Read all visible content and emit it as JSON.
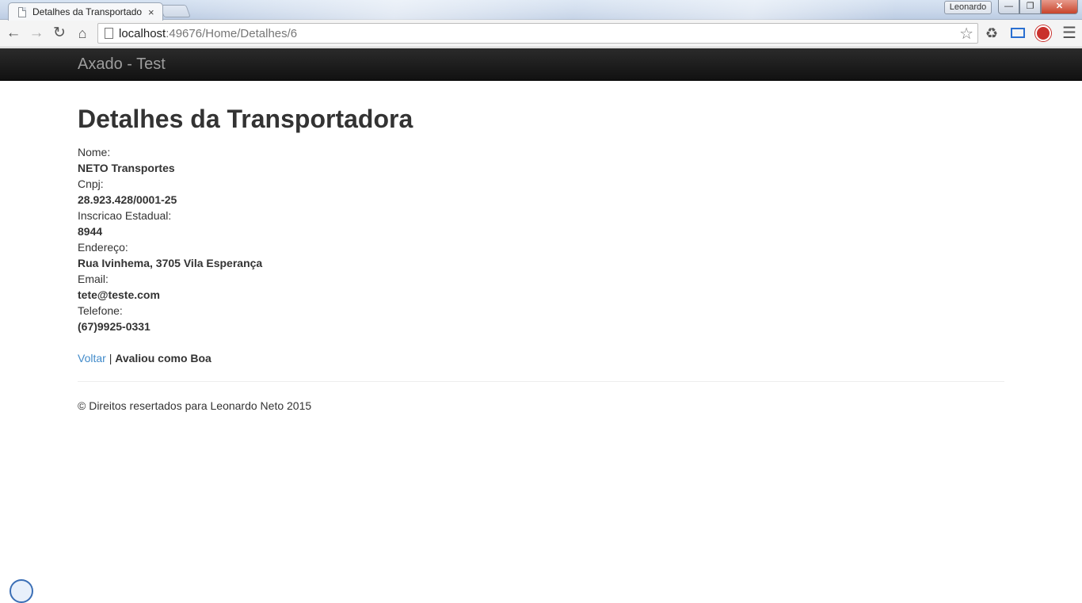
{
  "browser": {
    "tab_title": "Detalhes da Transportado",
    "tab_close": "×",
    "profile_name": "Leonardo",
    "url_host": "localhost",
    "url_rest": ":49676/Home/Detalhes/6",
    "icons": [
      "back-arrow-icon",
      "forward-arrow-icon",
      "reload-icon",
      "home-icon",
      "star-icon",
      "recycle-icon",
      "screen-capture-icon",
      "adblock-icon",
      "menu-icon"
    ]
  },
  "navbar": {
    "brand": "Axado - Test"
  },
  "page": {
    "title": "Detalhes da Transportadora",
    "fields": [
      {
        "label": "Nome:",
        "value": "NETO Transportes"
      },
      {
        "label": "Cnpj:",
        "value": "28.923.428/0001-25"
      },
      {
        "label": "Inscricao Estadual:",
        "value": "8944"
      },
      {
        "label": "Endereço:",
        "value": "Rua Ivinhema, 3705 Vila Esperança"
      },
      {
        "label": "Email:",
        "value": "tete@teste.com"
      },
      {
        "label": "Telefone:",
        "value": "(67)9925-0331"
      }
    ],
    "back_link": "Voltar",
    "separator": "|",
    "rating": "Avaliou como Boa"
  },
  "footer": {
    "text": "© Direitos resertados para Leonardo Neto 2015"
  },
  "colors": {
    "link": "#428bca",
    "navbar": "#222222",
    "text": "#333333"
  }
}
